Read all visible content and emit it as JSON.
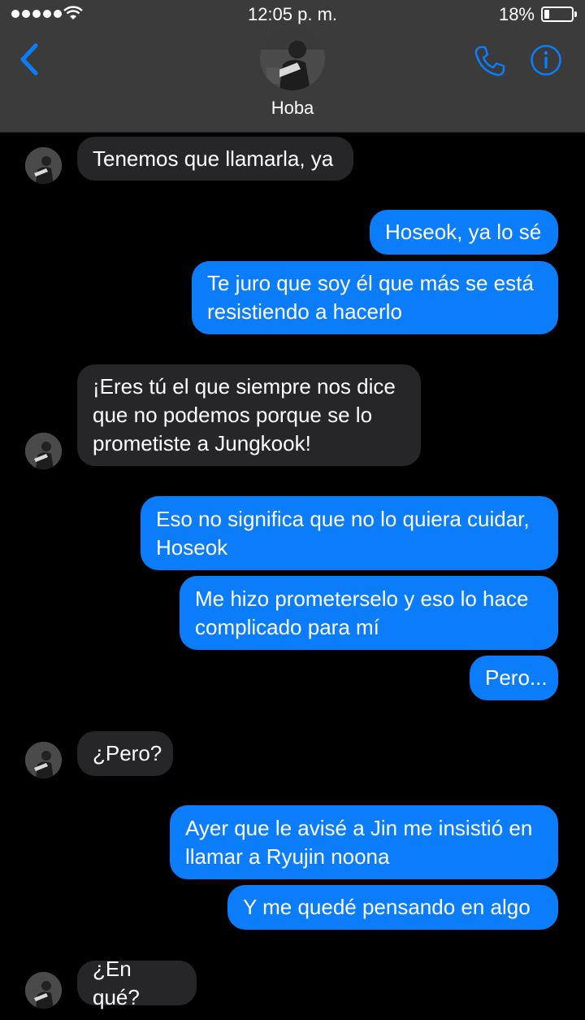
{
  "status_bar": {
    "time": "12:05 p. m.",
    "battery_percent": "18%",
    "battery_level": 0.18,
    "signal_bars": 5
  },
  "header": {
    "contact_name": "Hoba",
    "icons": {
      "back": "chevron-left-icon",
      "call": "phone-icon",
      "info": "info-icon"
    },
    "accent_color": "#0b7dfb"
  },
  "messages": [
    {
      "from": "them",
      "text": "Tenemos que llamarla, ya"
    },
    {
      "from": "me",
      "text": "Hoseok, ya lo sé"
    },
    {
      "from": "me",
      "text": "Te juro que soy él que más se está resistiendo a hacerlo"
    },
    {
      "from": "them",
      "text": "¡Eres tú el que siempre nos dice que no podemos porque se lo prometiste a Jungkook!"
    },
    {
      "from": "me",
      "text": "Eso no significa que no lo quiera cuidar, Hoseok"
    },
    {
      "from": "me",
      "text": "Me hizo prometerselo y eso lo hace complicado para mí"
    },
    {
      "from": "me",
      "text": "Pero..."
    },
    {
      "from": "them",
      "text": "¿Pero?"
    },
    {
      "from": "me",
      "text": "Ayer que le avisé a Jin me insistió en llamar a Ryujin noona"
    },
    {
      "from": "me",
      "text": "Y me quedé pensando en algo"
    },
    {
      "from": "them",
      "text": "¿En qué?"
    }
  ]
}
